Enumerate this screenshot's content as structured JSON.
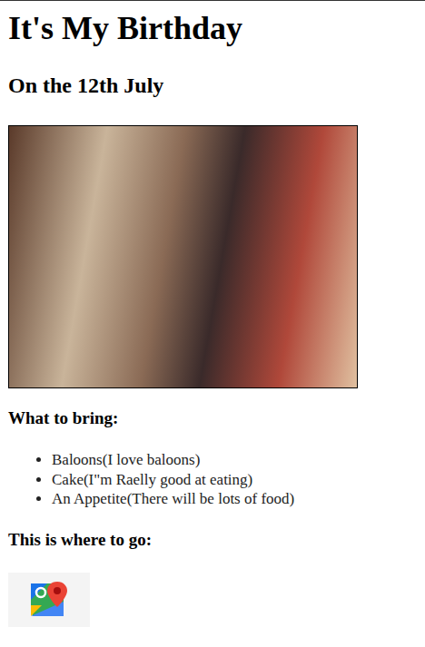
{
  "title": "It's My Birthday",
  "subtitle": "On the 12th July",
  "bring": {
    "heading": "What to bring:",
    "items": [
      "Baloons(I love baloons)",
      "Cake(I\"m Raelly good at eating)",
      "An Appetite(There will be lots of food)"
    ]
  },
  "where": {
    "heading": "This is where to go:"
  }
}
